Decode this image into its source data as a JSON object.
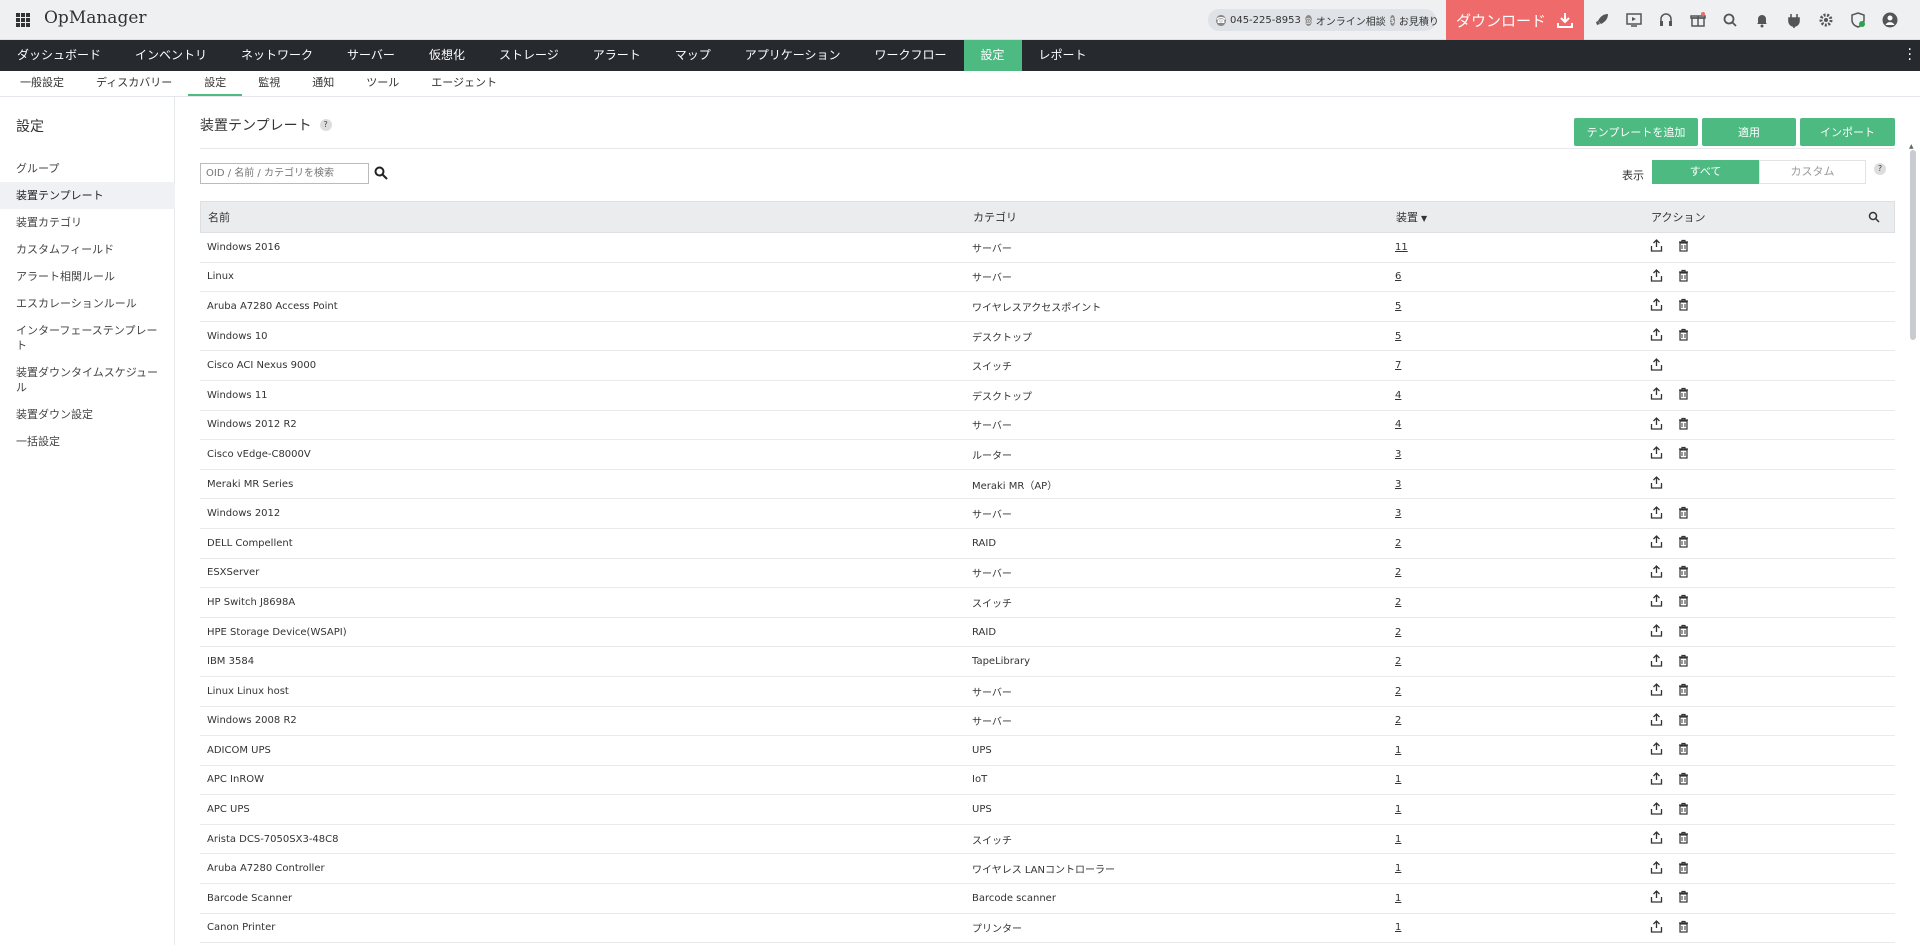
{
  "app": {
    "title": "OpManager"
  },
  "header": {
    "phone": "045-225-8953",
    "online_consult": "オンライン相談",
    "quote": "お見積り",
    "download": "ダウンロード",
    "icons": [
      "rocket-icon",
      "screen-play-icon",
      "headset-icon",
      "gift-icon",
      "search-icon",
      "bell-icon",
      "plug-icon",
      "gear-icon",
      "shield-icon",
      "user-icon"
    ]
  },
  "main_nav": {
    "items": [
      "ダッシュボード",
      "インベントリ",
      "ネットワーク",
      "サーバー",
      "仮想化",
      "ストレージ",
      "アラート",
      "マップ",
      "アプリケーション",
      "ワークフロー",
      "設定",
      "レポート"
    ],
    "active": "設定"
  },
  "sub_nav": {
    "items": [
      "一般設定",
      "ディスカバリー",
      "設定",
      "監視",
      "通知",
      "ツール",
      "エージェント"
    ],
    "active": "設定"
  },
  "sidebar": {
    "title": "設定",
    "items": [
      "グループ",
      "装置テンプレート",
      "装置カテゴリ",
      "カスタムフィールド",
      "アラート相関ルール",
      "エスカレーションルール",
      "インターフェーステンプレート",
      "装置ダウンタイムスケジュール",
      "装置ダウン設定",
      "一括設定"
    ],
    "active": "装置テンプレート"
  },
  "page": {
    "title": "装置テンプレート",
    "buttons": {
      "add": "テンプレートを追加",
      "apply": "適用",
      "import": "インポート"
    },
    "search_placeholder": "OID / 名前 / カテゴリを検索",
    "show_label": "表示",
    "filter_all": "すべて",
    "filter_custom": "カスタム"
  },
  "table": {
    "headers": {
      "name": "名前",
      "category": "カテゴリ",
      "devices": "装置",
      "actions": "アクション"
    },
    "rows": [
      {
        "name": "Windows 2016",
        "category": "サーバー",
        "devices": "11",
        "deletable": true
      },
      {
        "name": "Linux",
        "category": "サーバー",
        "devices": "6",
        "deletable": true
      },
      {
        "name": "Aruba A7280 Access Point",
        "category": "ワイヤレスアクセスポイント",
        "devices": "5",
        "deletable": true
      },
      {
        "name": "Windows 10",
        "category": "デスクトップ",
        "devices": "5",
        "deletable": true
      },
      {
        "name": "Cisco ACI Nexus 9000",
        "category": "スイッチ",
        "devices": "7",
        "deletable": false
      },
      {
        "name": "Windows 11",
        "category": "デスクトップ",
        "devices": "4",
        "deletable": true
      },
      {
        "name": "Windows 2012 R2",
        "category": "サーバー",
        "devices": "4",
        "deletable": true
      },
      {
        "name": "Cisco vEdge-C8000V",
        "category": "ルーター",
        "devices": "3",
        "deletable": true
      },
      {
        "name": "Meraki MR Series",
        "category": "Meraki MR（AP）",
        "devices": "3",
        "deletable": false
      },
      {
        "name": "Windows 2012",
        "category": "サーバー",
        "devices": "3",
        "deletable": true
      },
      {
        "name": "DELL Compellent",
        "category": "RAID",
        "devices": "2",
        "deletable": true
      },
      {
        "name": "ESXServer",
        "category": "サーバー",
        "devices": "2",
        "deletable": true
      },
      {
        "name": "HP Switch J8698A",
        "category": "スイッチ",
        "devices": "2",
        "deletable": true
      },
      {
        "name": "HPE Storage Device(WSAPI)",
        "category": "RAID",
        "devices": "2",
        "deletable": true
      },
      {
        "name": "IBM 3584",
        "category": "TapeLibrary",
        "devices": "2",
        "deletable": true
      },
      {
        "name": "Linux Linux host",
        "category": "サーバー",
        "devices": "2",
        "deletable": true
      },
      {
        "name": "Windows 2008 R2",
        "category": "サーバー",
        "devices": "2",
        "deletable": true
      },
      {
        "name": "ADICOM UPS",
        "category": "UPS",
        "devices": "1",
        "deletable": true
      },
      {
        "name": "APC InROW",
        "category": "IoT",
        "devices": "1",
        "deletable": true
      },
      {
        "name": "APC UPS",
        "category": "UPS",
        "devices": "1",
        "deletable": true
      },
      {
        "name": "Arista DCS-7050SX3-48C8",
        "category": "スイッチ",
        "devices": "1",
        "deletable": true
      },
      {
        "name": "Aruba A7280 Controller",
        "category": "ワイヤレス LANコントローラー",
        "devices": "1",
        "deletable": true
      },
      {
        "name": "Barcode Scanner",
        "category": "Barcode scanner",
        "devices": "1",
        "deletable": true
      },
      {
        "name": "Canon Printer",
        "category": "プリンター",
        "devices": "1",
        "deletable": true
      }
    ]
  },
  "colors": {
    "accent": "#4cba81",
    "download": "#ef6b6b",
    "nav_bg": "#26292d"
  }
}
